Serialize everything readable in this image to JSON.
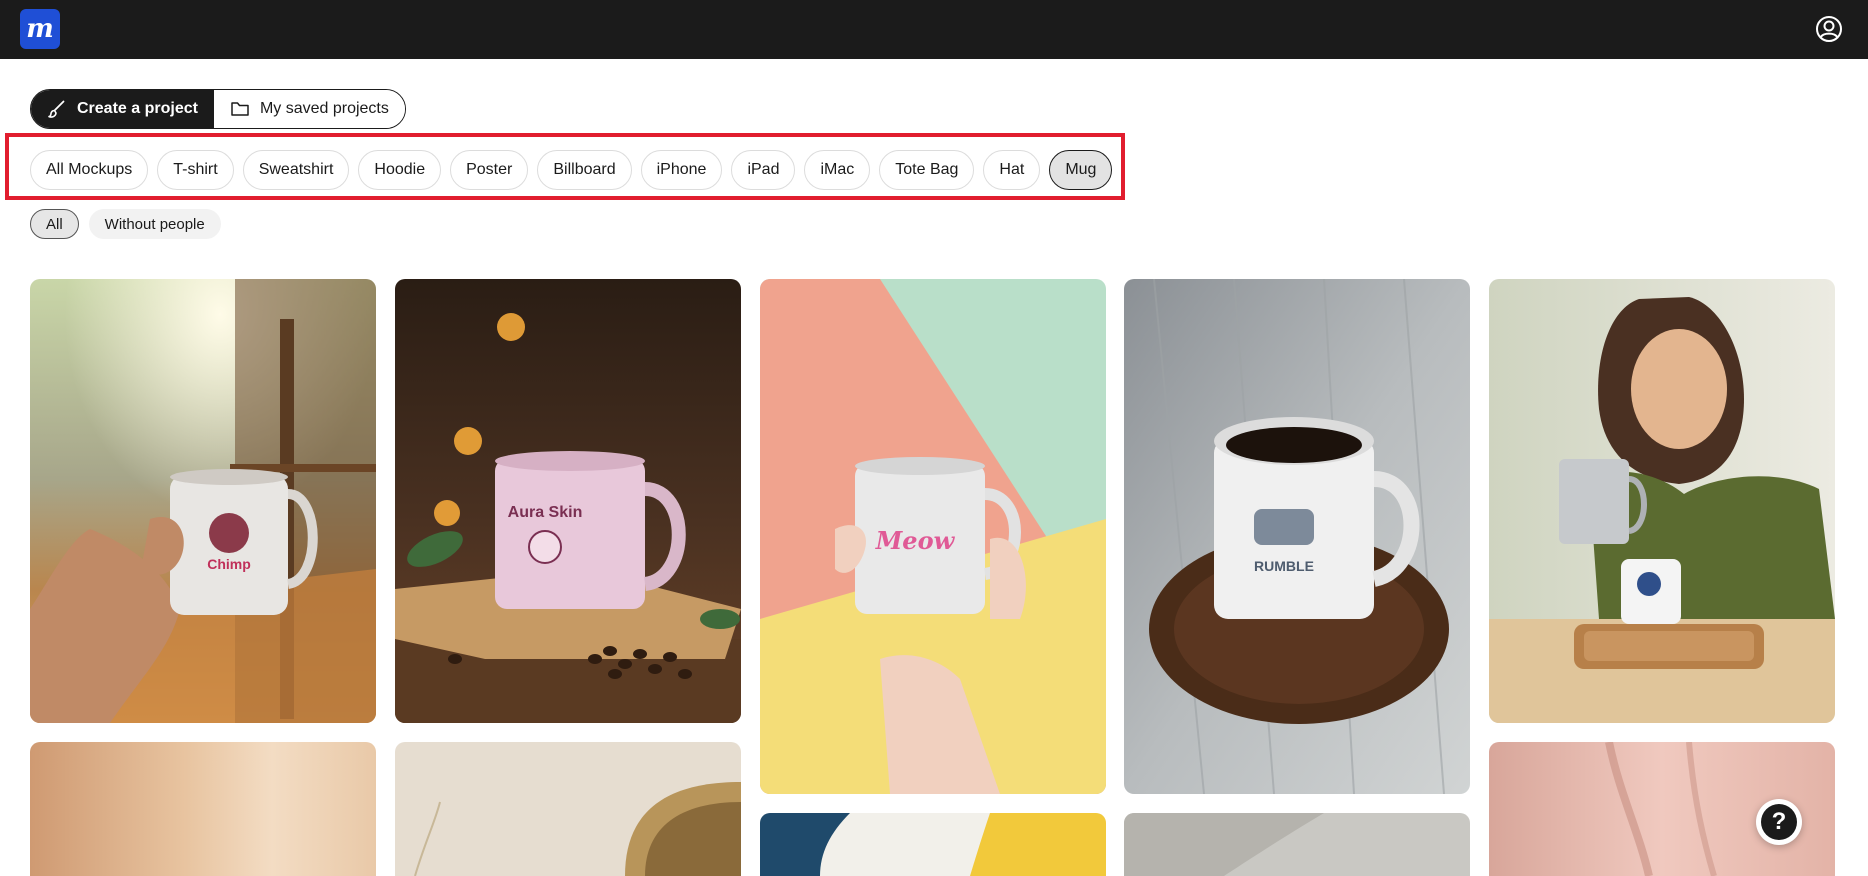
{
  "header": {
    "logo_letter": "m",
    "logo_color": "#1f4fd6"
  },
  "segmented": {
    "create_label": "Create a project",
    "saved_label": "My saved projects"
  },
  "categories": [
    {
      "label": "All Mockups",
      "selected": false
    },
    {
      "label": "T-shirt",
      "selected": false
    },
    {
      "label": "Sweatshirt",
      "selected": false
    },
    {
      "label": "Hoodie",
      "selected": false
    },
    {
      "label": "Poster",
      "selected": false
    },
    {
      "label": "Billboard",
      "selected": false
    },
    {
      "label": "iPhone",
      "selected": false
    },
    {
      "label": "iPad",
      "selected": false
    },
    {
      "label": "iMac",
      "selected": false
    },
    {
      "label": "Tote Bag",
      "selected": false
    },
    {
      "label": "Hat",
      "selected": false
    },
    {
      "label": "Mug",
      "selected": true
    }
  ],
  "filters": {
    "all_label": "All",
    "without_people_label": "Without people"
  },
  "mockups": [
    {
      "logo_text": "Chimp"
    },
    {
      "logo_text": "Aura Skin"
    },
    {
      "logo_text": "Meow"
    },
    {
      "logo_text": "RUMBLE"
    },
    {
      "logo_text": ""
    }
  ],
  "help": {
    "label": "?"
  },
  "colors": {
    "topbar": "#1b1b1b",
    "highlight": "#e11d2e"
  }
}
